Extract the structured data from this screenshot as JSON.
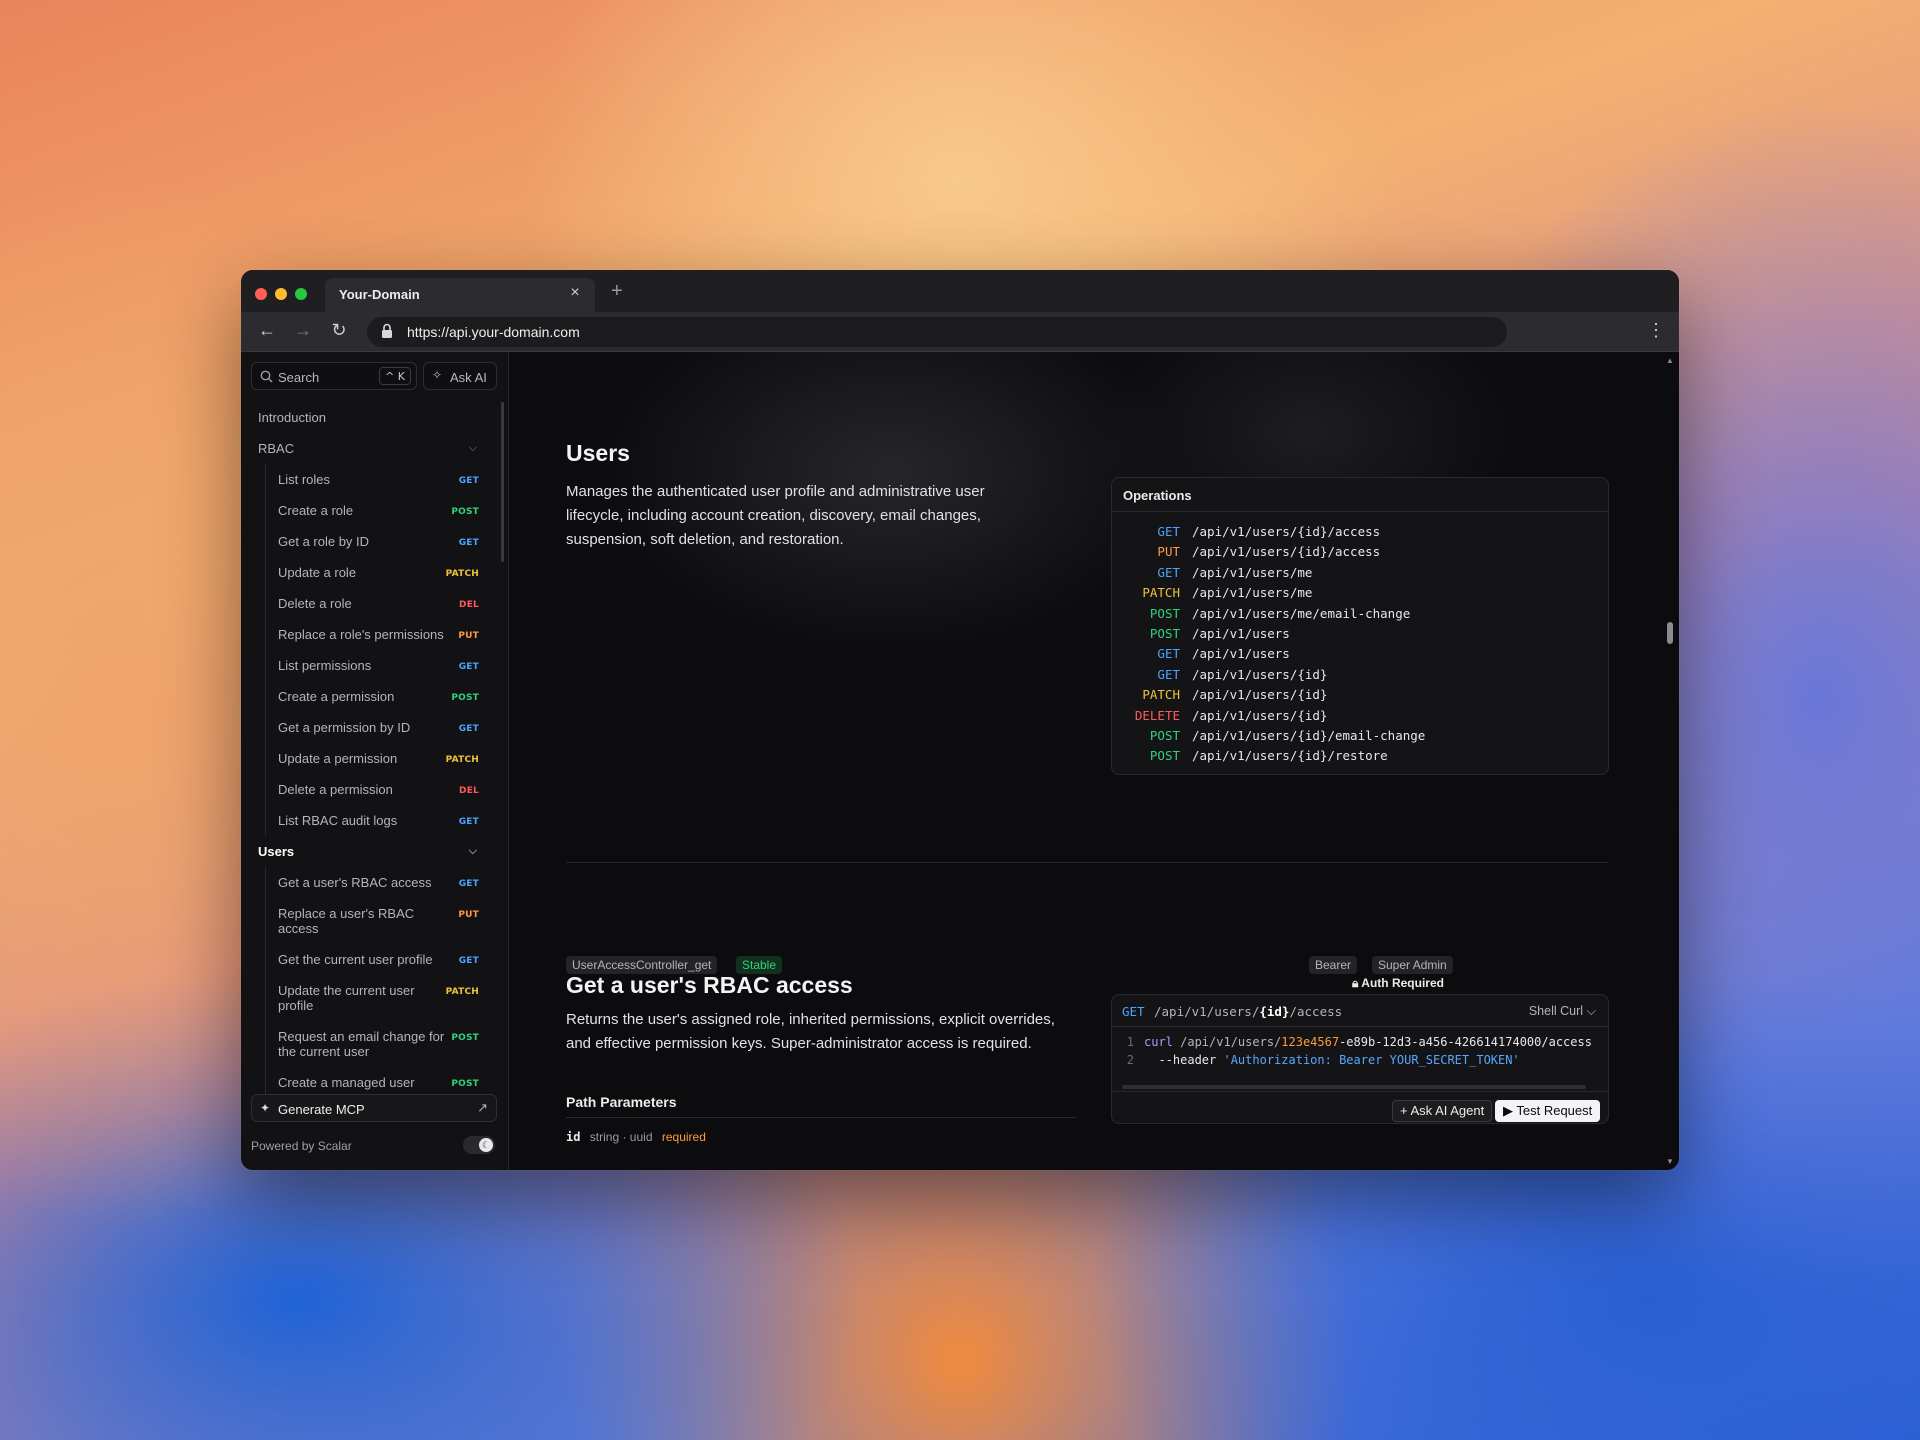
{
  "browser": {
    "tab_title": "Your-Domain",
    "tab_close": "×",
    "new_tab": "+",
    "url": "https://api.your-domain.com"
  },
  "sidebar": {
    "search_placeholder": "Search",
    "search_shortcut": "^ K",
    "ask_ai": "Ask AI",
    "introduction": "Introduction",
    "rbac_label": "RBAC",
    "rbac_items": [
      {
        "label": "List roles",
        "method": "GET"
      },
      {
        "label": "Create a role",
        "method": "POST"
      },
      {
        "label": "Get a role by ID",
        "method": "GET"
      },
      {
        "label": "Update a role",
        "method": "PATCH"
      },
      {
        "label": "Delete a role",
        "method": "DEL"
      },
      {
        "label": "Replace a role's permissions",
        "method": "PUT"
      },
      {
        "label": "List permissions",
        "method": "GET"
      },
      {
        "label": "Create a permission",
        "method": "POST"
      },
      {
        "label": "Get a permission by ID",
        "method": "GET"
      },
      {
        "label": "Update a permission",
        "method": "PATCH"
      },
      {
        "label": "Delete a permission",
        "method": "DEL"
      },
      {
        "label": "List RBAC audit logs",
        "method": "GET"
      }
    ],
    "users_label": "Users",
    "users_items": [
      {
        "label": "Get a user's RBAC access",
        "method": "GET"
      },
      {
        "label": "Replace a user's RBAC access",
        "method": "PUT"
      },
      {
        "label": "Get the current user profile",
        "method": "GET"
      },
      {
        "label": "Update the current user profile",
        "method": "PATCH"
      },
      {
        "label": "Request an email change for the current user",
        "method": "POST"
      },
      {
        "label": "Create a managed user",
        "method": "POST"
      }
    ],
    "generate_mcp": "Generate MCP",
    "powered_by": "Powered by Scalar"
  },
  "section": {
    "title": "Users",
    "description": "Manages the authenticated user profile and administrative user lifecycle, including account creation, discovery, email changes, suspension, soft deletion, and restoration.",
    "operations_title": "Operations",
    "operations": [
      {
        "method": "GET",
        "path": "/api/v1/users/{id}/access"
      },
      {
        "method": "PUT",
        "path": "/api/v1/users/{id}/access"
      },
      {
        "method": "GET",
        "path": "/api/v1/users/me"
      },
      {
        "method": "PATCH",
        "path": "/api/v1/users/me"
      },
      {
        "method": "POST",
        "path": "/api/v1/users/me/email-change"
      },
      {
        "method": "POST",
        "path": "/api/v1/users"
      },
      {
        "method": "GET",
        "path": "/api/v1/users"
      },
      {
        "method": "GET",
        "path": "/api/v1/users/{id}"
      },
      {
        "method": "PATCH",
        "path": "/api/v1/users/{id}"
      },
      {
        "method": "DELETE",
        "path": "/api/v1/users/{id}"
      },
      {
        "method": "POST",
        "path": "/api/v1/users/{id}/email-change"
      },
      {
        "method": "POST",
        "path": "/api/v1/users/{id}/restore"
      }
    ]
  },
  "endpoint": {
    "operation_id": "UserAccessController_get",
    "stability": "Stable",
    "auth_bearer": "Bearer",
    "auth_role": "Super Admin",
    "auth_required": "Auth Required",
    "title": "Get a user's RBAC access",
    "description": "Returns the user's assigned role, inherited permissions, explicit overrides, and effective permission keys. Super-administrator access is required.",
    "path_params_title": "Path Parameters",
    "param_name": "id",
    "param_type": "string · uuid",
    "param_required": "required",
    "code": {
      "method": "GET",
      "path_prefix": "/api/v1/users/",
      "path_param": "{id}",
      "path_suffix": "/access",
      "language": "Shell Curl",
      "line1_num": "1",
      "line1_cmd": "curl",
      "line1_url": " /api/v1/users/",
      "line1_id_a": "123e4567",
      "line1_id_b": "-e89b-12d3-a456-426614174000/access",
      "line2_num": "2",
      "line2_flag": "  --header ",
      "line2_str": "'Authorization: Bearer YOUR_SECRET_TOKEN'",
      "ask_agent": "Ask AI Agent",
      "test_request": "Test Request"
    }
  },
  "colors": {
    "get": "#4aa3ff",
    "post": "#34d17a",
    "patch": "#f0c23a",
    "delete": "#ff5a5a",
    "put": "#ff9a3c"
  }
}
